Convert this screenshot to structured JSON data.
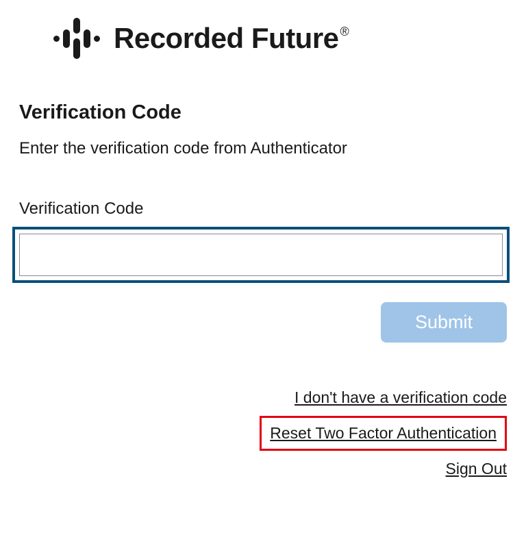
{
  "brand": {
    "name": "Recorded Future",
    "registered_mark": "®"
  },
  "page": {
    "title": "Verification Code",
    "instruction": "Enter the verification code from Authenticator"
  },
  "form": {
    "field_label": "Verification Code",
    "code_value": "",
    "submit_label": "Submit"
  },
  "links": {
    "no_code": "I don't have a verification code",
    "reset_2fa": "Reset Two Factor Authentication",
    "sign_out": "Sign Out"
  },
  "highlights": {
    "input_border_color": "#0a4f7a",
    "reset_border_color": "#e3000f"
  }
}
